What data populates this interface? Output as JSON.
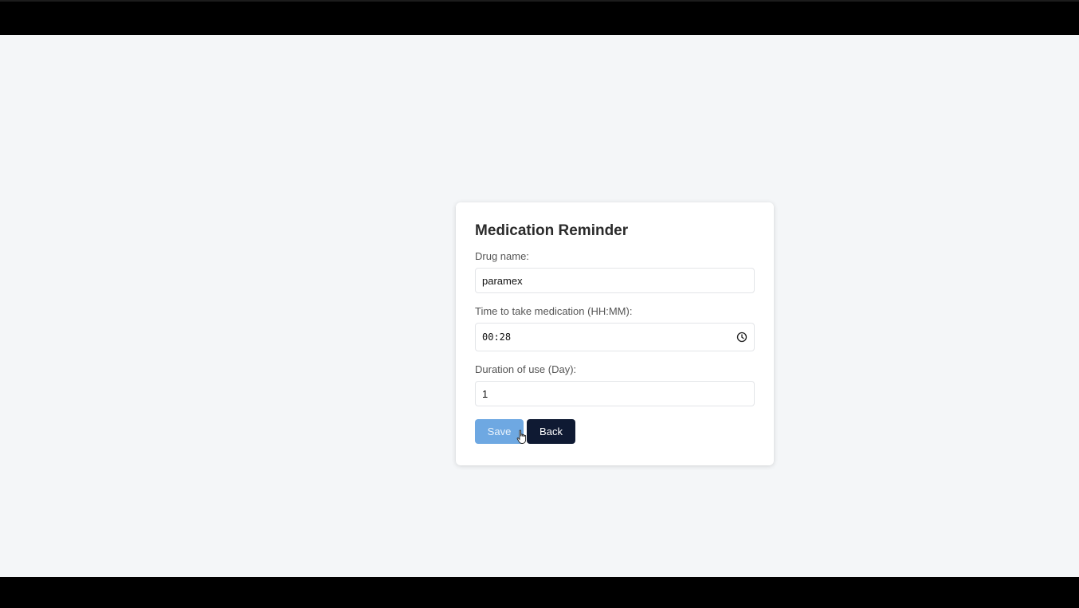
{
  "form": {
    "title": "Medication Reminder",
    "drug_name": {
      "label": "Drug name:",
      "value": "paramex"
    },
    "time": {
      "label": "Time to take medication (HH:MM):",
      "value": "00:28",
      "icon": "clock-icon"
    },
    "duration": {
      "label": "Duration of use (Day):",
      "value": "1"
    },
    "buttons": {
      "save_label": "Save",
      "back_label": "Back"
    }
  },
  "colors": {
    "page_background": "#f4f6f8",
    "save_button": "#6ea8e2",
    "back_button": "#0f1a33"
  }
}
